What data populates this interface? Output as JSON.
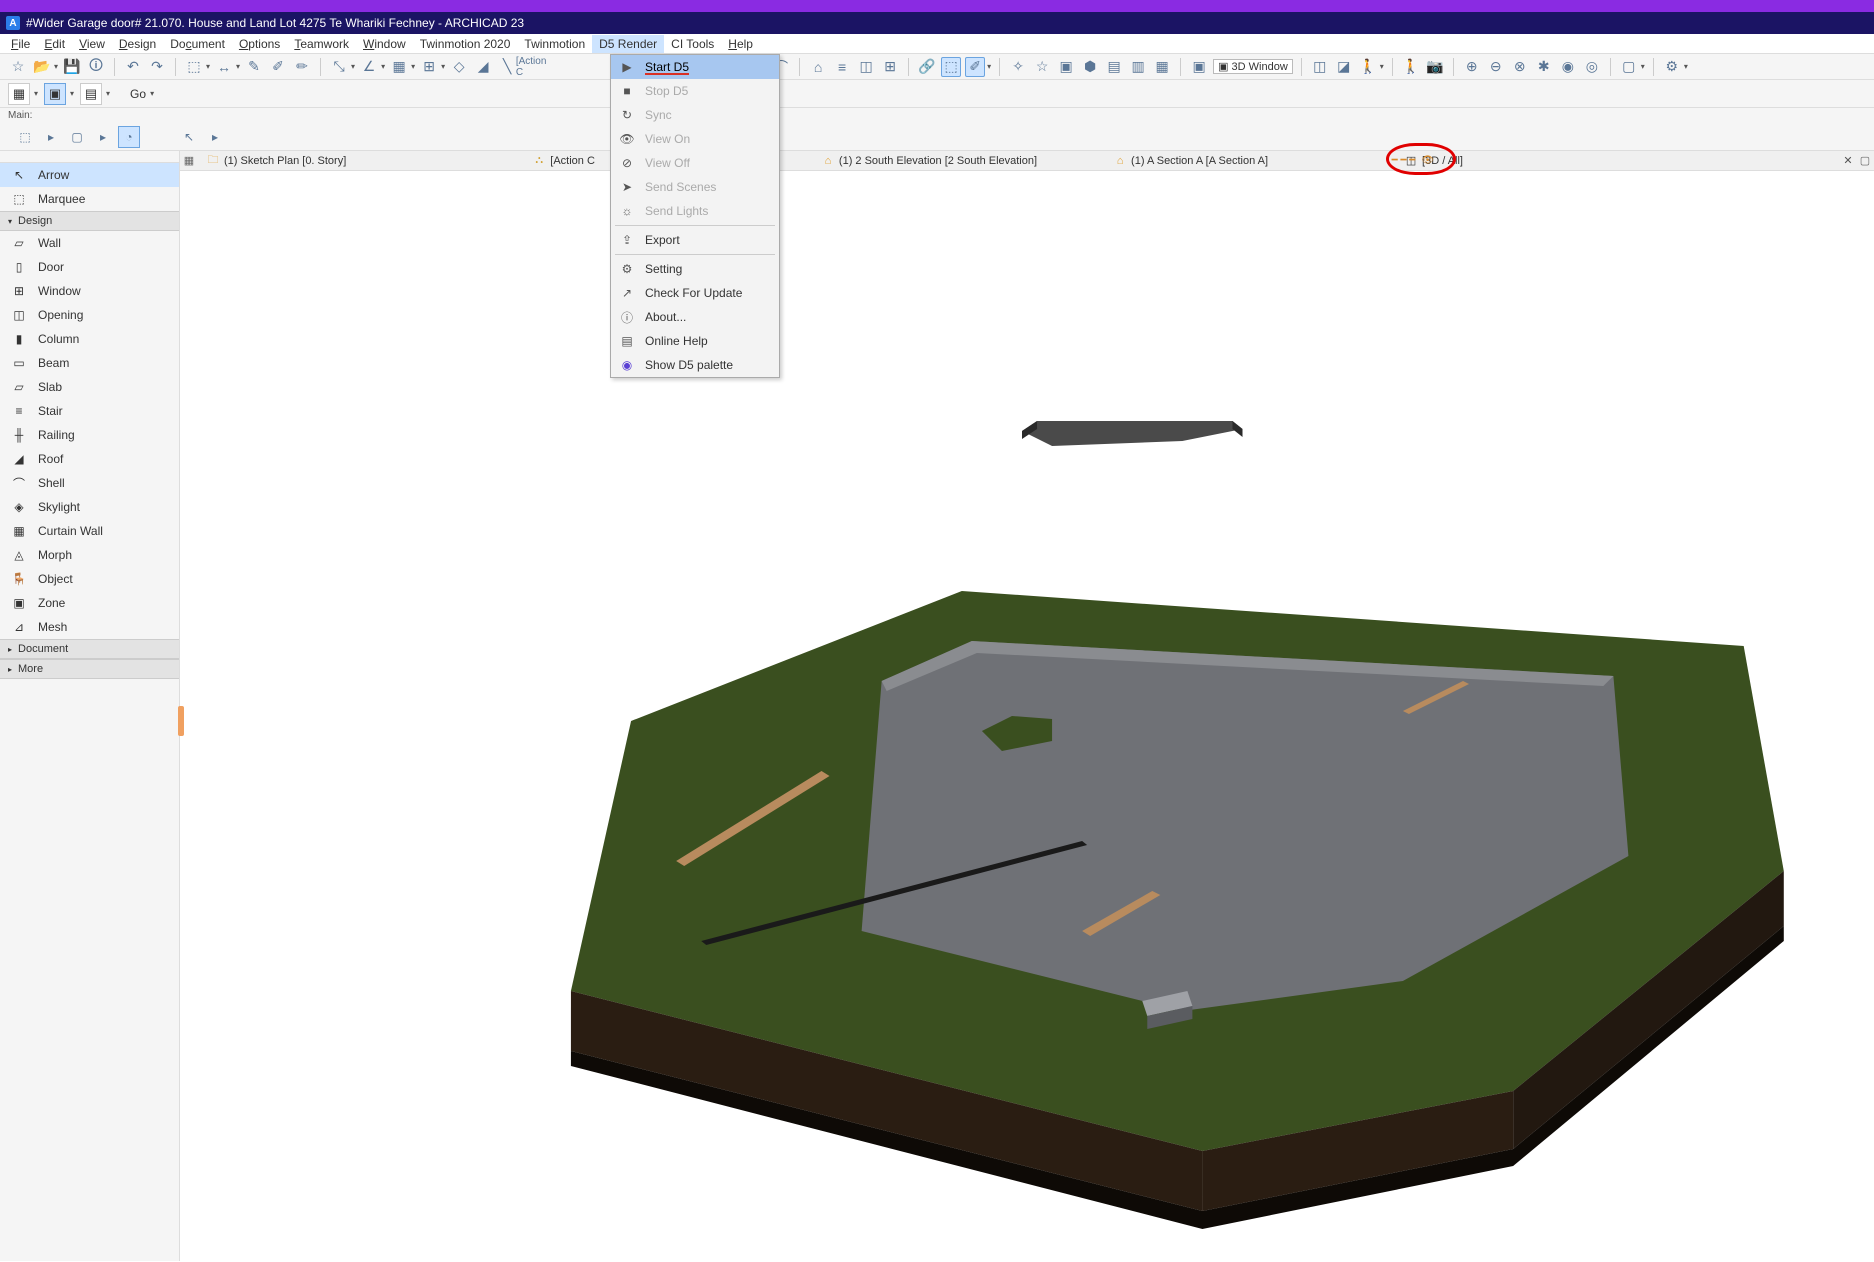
{
  "titlebar": {
    "title": "#Wider Garage door# 21.070. House and Land Lot 4275 Te Whariki Fechney - ARCHICAD 23"
  },
  "menubar": {
    "items": [
      {
        "label": "File",
        "u": "F"
      },
      {
        "label": "Edit",
        "u": "E"
      },
      {
        "label": "View",
        "u": "V"
      },
      {
        "label": "Design",
        "u": "D"
      },
      {
        "label": "Document",
        "u": "c"
      },
      {
        "label": "Options",
        "u": "O"
      },
      {
        "label": "Teamwork",
        "u": "T"
      },
      {
        "label": "Window",
        "u": "W"
      },
      {
        "label": "Twinmotion 2020",
        "u": ""
      },
      {
        "label": "Twinmotion",
        "u": ""
      },
      {
        "label": "D5 Render",
        "u": "",
        "active": true
      },
      {
        "label": "CI Tools",
        "u": ""
      },
      {
        "label": "Help",
        "u": "H"
      }
    ]
  },
  "toolbar2": {
    "go_label": "Go"
  },
  "main_label": "Main:",
  "sidebar": {
    "top": [
      {
        "label": "Arrow",
        "icon": "arrow",
        "selected": true
      },
      {
        "label": "Marquee",
        "icon": "marquee"
      }
    ],
    "design_label": "Design",
    "design": [
      {
        "label": "Wall",
        "icon": "wall"
      },
      {
        "label": "Door",
        "icon": "door"
      },
      {
        "label": "Window",
        "icon": "window"
      },
      {
        "label": "Opening",
        "icon": "opening"
      },
      {
        "label": "Column",
        "icon": "column"
      },
      {
        "label": "Beam",
        "icon": "beam"
      },
      {
        "label": "Slab",
        "icon": "slab"
      },
      {
        "label": "Stair",
        "icon": "stair"
      },
      {
        "label": "Railing",
        "icon": "railing"
      },
      {
        "label": "Roof",
        "icon": "roof"
      },
      {
        "label": "Shell",
        "icon": "shell"
      },
      {
        "label": "Skylight",
        "icon": "skylight"
      },
      {
        "label": "Curtain Wall",
        "icon": "curtainwall"
      },
      {
        "label": "Morph",
        "icon": "morph"
      },
      {
        "label": "Object",
        "icon": "object"
      },
      {
        "label": "Zone",
        "icon": "zone"
      },
      {
        "label": "Mesh",
        "icon": "mesh"
      }
    ],
    "document_label": "Document",
    "more_label": "More"
  },
  "tabs": {
    "items": [
      {
        "label": "(1) Sketch Plan [0. Story]",
        "icon": "folder"
      },
      {
        "label": "[Action C",
        "icon": "section",
        "truncated": true
      },
      {
        "label": "(1) 2 South Elevation [2 South Elevation]",
        "icon": "elevation"
      },
      {
        "label": "(1) A Section A [A Section A]",
        "icon": "elevation"
      },
      {
        "label": "[3D / All]",
        "icon": "3d",
        "circled": true
      }
    ]
  },
  "dropdown": {
    "items": [
      {
        "label": "Start D5",
        "icon": "play",
        "highlighted": true,
        "underlined": true
      },
      {
        "label": "Stop D5",
        "icon": "stop",
        "disabled": true
      },
      {
        "label": "Sync",
        "icon": "sync",
        "disabled": true
      },
      {
        "label": "View On",
        "icon": "viewon",
        "disabled": true
      },
      {
        "label": "View Off",
        "icon": "viewoff",
        "disabled": true
      },
      {
        "label": "Send Scenes",
        "icon": "send",
        "disabled": true
      },
      {
        "label": "Send Lights",
        "icon": "lights",
        "disabled": true
      },
      {
        "sep": true
      },
      {
        "label": "Export",
        "icon": "export"
      },
      {
        "sep": true
      },
      {
        "label": "Setting",
        "icon": "setting"
      },
      {
        "label": "Check For Update",
        "icon": "update"
      },
      {
        "label": "About...",
        "icon": "about"
      },
      {
        "label": "Online Help",
        "icon": "help"
      },
      {
        "label": "Show D5 palette",
        "icon": "palette"
      }
    ]
  },
  "toolbar3d": {
    "label": "3D Window"
  }
}
